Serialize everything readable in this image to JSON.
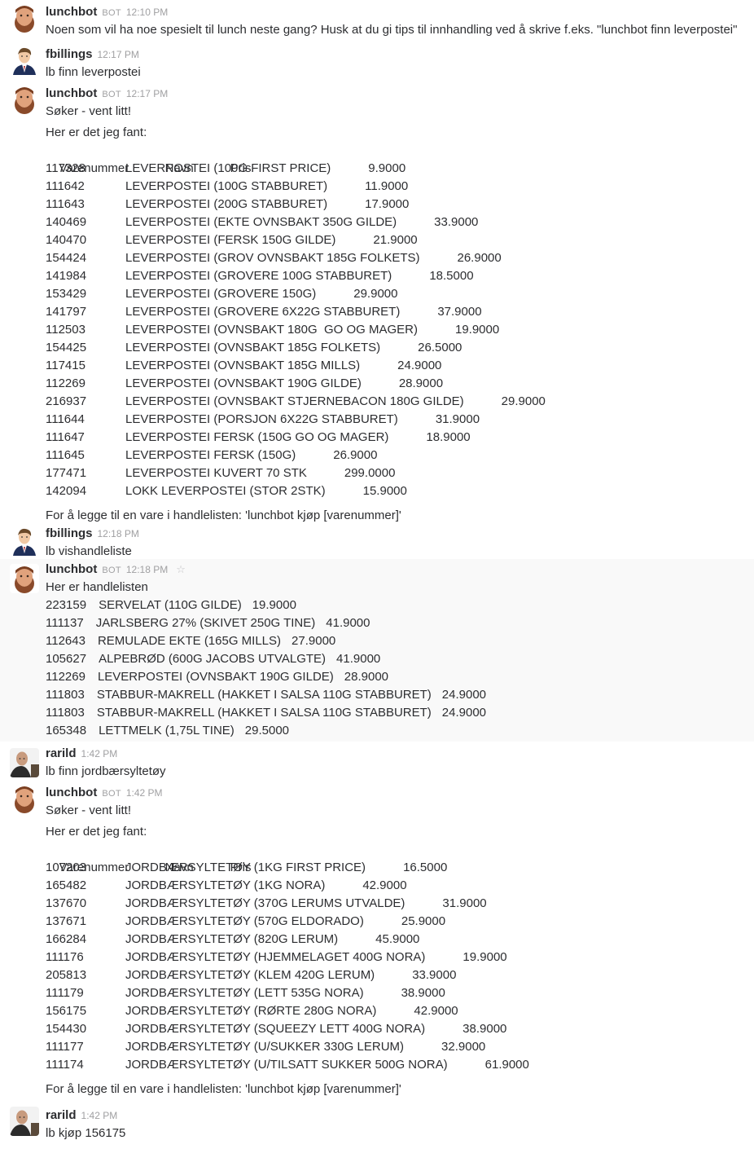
{
  "messages": [
    {
      "author": "lunchbot",
      "bot_badge": "BOT",
      "time": "12:10 PM",
      "text": "Noen som vil ha noe spesielt til lunch neste gang? Husk at du gi tips til innhandling ved å skrive f.eks. \"lunchbot finn leverpostei\""
    },
    {
      "author": "fbillings",
      "time": "12:17 PM",
      "text": "lb finn leverpostei"
    },
    {
      "author": "lunchbot",
      "bot_badge": "BOT",
      "time": "12:17 PM",
      "searching": "Søker - vent litt!",
      "found": "Her er det jeg fant:",
      "headers": [
        "Varenummer",
        "Navn",
        "Pris"
      ],
      "rows": [
        {
          "id": "117328",
          "name": "LEVERPOSTEI (100G FIRST PRICE)",
          "price": "9.9000"
        },
        {
          "id": "111642",
          "name": "LEVERPOSTEI (100G STABBURET)",
          "price": "11.9000"
        },
        {
          "id": "111643",
          "name": "LEVERPOSTEI (200G STABBURET)",
          "price": "17.9000"
        },
        {
          "id": "140469",
          "name": "LEVERPOSTEI (EKTE OVNSBAKT 350G GILDE)",
          "price": "33.9000"
        },
        {
          "id": "140470",
          "name": "LEVERPOSTEI (FERSK 150G GILDE)",
          "price": "21.9000"
        },
        {
          "id": "154424",
          "name": "LEVERPOSTEI (GROV OVNSBAKT 185G FOLKETS)",
          "price": "26.9000"
        },
        {
          "id": "141984",
          "name": "LEVERPOSTEI (GROVERE 100G STABBURET)",
          "price": "18.5000"
        },
        {
          "id": "153429",
          "name": "LEVERPOSTEI (GROVERE 150G)",
          "price": "29.9000"
        },
        {
          "id": "141797",
          "name": "LEVERPOSTEI (GROVERE 6X22G STABBURET)",
          "price": "37.9000"
        },
        {
          "id": "112503",
          "name": "LEVERPOSTEI (OVNSBAKT 180G  GO OG MAGER)",
          "price": "19.9000"
        },
        {
          "id": "154425",
          "name": "LEVERPOSTEI (OVNSBAKT 185G FOLKETS)",
          "price": "26.5000"
        },
        {
          "id": "117415",
          "name": "LEVERPOSTEI (OVNSBAKT 185G MILLS)",
          "price": "24.9000"
        },
        {
          "id": "112269",
          "name": "LEVERPOSTEI (OVNSBAKT 190G GILDE)",
          "price": "28.9000"
        },
        {
          "id": "216937",
          "name": "LEVERPOSTEI (OVNSBAKT STJERNEBACON 180G GILDE)",
          "price": "29.9000"
        },
        {
          "id": "111644",
          "name": "LEVERPOSTEI (PORSJON 6X22G STABBURET)",
          "price": "31.9000"
        },
        {
          "id": "111647",
          "name": "LEVERPOSTEI FERSK (150G GO OG MAGER)",
          "price": "18.9000"
        },
        {
          "id": "111645",
          "name": "LEVERPOSTEI FERSK (150G)",
          "price": "26.9000"
        },
        {
          "id": "177471",
          "name": "LEVERPOSTEI KUVERT 70 STK",
          "price": "299.0000"
        },
        {
          "id": "142094",
          "name": "LOKK LEVERPOSTEI (STOR 2STK)",
          "price": "15.9000"
        }
      ],
      "footer": "For å legge til en vare i handlelisten: 'lunchbot kjøp [varenummer]'"
    },
    {
      "author": "fbillings",
      "time": "12:18 PM",
      "text": "lb vishandleliste"
    },
    {
      "author": "lunchbot",
      "bot_badge": "BOT",
      "time": "12:18 PM",
      "star_icon": "☆",
      "intro": "Her er handlelisten",
      "rows": [
        {
          "id": "223159",
          "name": "SERVELAT (110G GILDE)",
          "price": "19.9000"
        },
        {
          "id": "111137",
          "name": "JARLSBERG 27% (SKIVET 250G TINE)",
          "price": "41.9000"
        },
        {
          "id": "112643",
          "name": "REMULADE EKTE (165G MILLS)",
          "price": "27.9000"
        },
        {
          "id": "105627",
          "name": "ALPEBRØD (600G JACOBS UTVALGTE)",
          "price": "41.9000"
        },
        {
          "id": "112269",
          "name": "LEVERPOSTEI (OVNSBAKT 190G GILDE)",
          "price": "28.9000"
        },
        {
          "id": "111803",
          "name": "STABBUR-MAKRELL (HAKKET I SALSA 110G STABBURET)",
          "price": "24.9000"
        },
        {
          "id": "111803",
          "name": "STABBUR-MAKRELL (HAKKET I SALSA 110G STABBURET)",
          "price": "24.9000"
        },
        {
          "id": "165348",
          "name": "LETTMELK (1,75L TINE)",
          "price": "29.5000"
        }
      ]
    },
    {
      "author": "rarild",
      "time": "1:42 PM",
      "text": "lb finn jordbærsyltetøy"
    },
    {
      "author": "lunchbot",
      "bot_badge": "BOT",
      "time": "1:42 PM",
      "searching": "Søker - vent litt!",
      "found": "Her er det jeg fant:",
      "headers": [
        "Varenummer",
        "Navn",
        "Pris"
      ],
      "rows": [
        {
          "id": "107203",
          "name": "JORDBÆRSYLTETØY (1KG FIRST PRICE)",
          "price": "16.5000"
        },
        {
          "id": "165482",
          "name": "JORDBÆRSYLTETØY (1KG NORA)",
          "price": "42.9000"
        },
        {
          "id": "137670",
          "name": "JORDBÆRSYLTETØY (370G LERUMS UTVALDE)",
          "price": "31.9000"
        },
        {
          "id": "137671",
          "name": "JORDBÆRSYLTETØY (570G ELDORADO)",
          "price": "25.9000"
        },
        {
          "id": "166284",
          "name": "JORDBÆRSYLTETØY (820G LERUM)",
          "price": "45.9000"
        },
        {
          "id": "111176",
          "name": "JORDBÆRSYLTETØY (HJEMMELAGET 400G NORA)",
          "price": "19.9000"
        },
        {
          "id": "205813",
          "name": "JORDBÆRSYLTETØY (KLEM 420G LERUM)",
          "price": "33.9000"
        },
        {
          "id": "111179",
          "name": "JORDBÆRSYLTETØY (LETT 535G NORA)",
          "price": "38.9000"
        },
        {
          "id": "156175",
          "name": "JORDBÆRSYLTETØY (RØRTE 280G NORA)",
          "price": "42.9000"
        },
        {
          "id": "154430",
          "name": "JORDBÆRSYLTETØY (SQUEEZY LETT 400G NORA)",
          "price": "38.9000"
        },
        {
          "id": "111177",
          "name": "JORDBÆRSYLTETØY (U/SUKKER 330G LERUM)",
          "price": "32.9000"
        },
        {
          "id": "111174",
          "name": "JORDBÆRSYLTETØY (U/TILSATT SUKKER 500G NORA)",
          "price": "61.9000"
        }
      ],
      "footer": "For å legge til en vare i handlelisten: 'lunchbot kjøp [varenummer]'"
    },
    {
      "author": "rarild",
      "time": "1:42 PM",
      "text": "lb kjøp 156175"
    }
  ]
}
